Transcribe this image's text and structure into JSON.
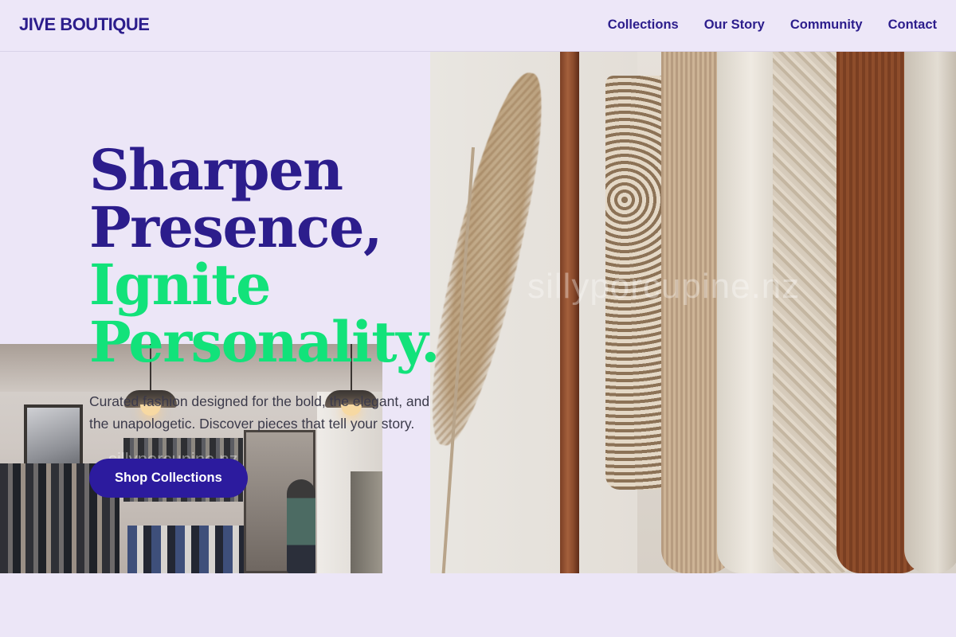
{
  "header": {
    "brand": "JIVE BOUTIQUE",
    "nav": [
      {
        "label": "Collections"
      },
      {
        "label": "Our Story"
      },
      {
        "label": "Community"
      },
      {
        "label": "Contact"
      }
    ]
  },
  "hero": {
    "title_lines": [
      {
        "text": "Sharpen",
        "color": "#2c1d8c"
      },
      {
        "text": "Presence,",
        "color": "#2c1d8c"
      },
      {
        "text": "Ignite",
        "color": "#12e27a"
      },
      {
        "text": "Personality.",
        "color": "#12e27a"
      }
    ],
    "description": "Curated fashion designed for the bold, the elegant, and the unapologetic. Discover pieces that tell your story.",
    "cta_label": "Shop Collections"
  },
  "images": {
    "rack_watermark": "sillyporcupine.nz",
    "store_watermark": "sillyporcupine.nz"
  },
  "colors": {
    "background": "#ece6f7",
    "brand_purple": "#2c1d8c",
    "accent_green": "#12e27a",
    "button": "#2c1b9e"
  }
}
